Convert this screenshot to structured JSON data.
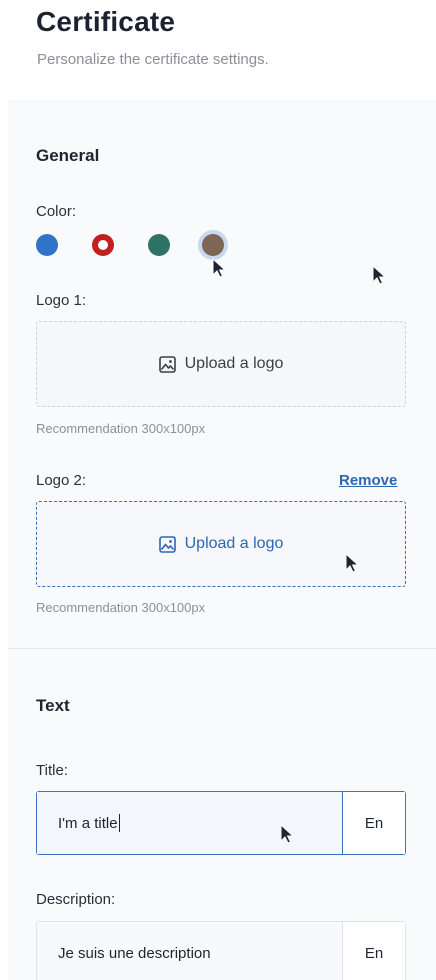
{
  "header": {
    "title": "Certificate",
    "subtitle": "Personalize the certificate settings."
  },
  "general": {
    "title": "General",
    "color_label": "Color:",
    "colors": [
      {
        "name": "blue",
        "hex": "#2f74c9",
        "selected": false
      },
      {
        "name": "red",
        "hex": "#c2201f",
        "selected": false
      },
      {
        "name": "teal",
        "hex": "#2e7466",
        "selected": false
      },
      {
        "name": "brown",
        "hex": "#7d6654",
        "selected": true
      }
    ],
    "logo1": {
      "label": "Logo 1:",
      "upload_label": "Upload a logo",
      "icon": "image-icon",
      "hint": "Recommendation 300x100px"
    },
    "logo2": {
      "label": "Logo 2:",
      "remove_label": "Remove",
      "upload_label": "Upload a logo",
      "icon": "image-icon",
      "hint": "Recommendation 300x100px"
    }
  },
  "text_section": {
    "title": "Text",
    "title_field": {
      "label": "Title:",
      "value": "I'm a title",
      "language": "En"
    },
    "description_field": {
      "label": "Description:",
      "value": "Je suis une description",
      "language": "En"
    }
  },
  "colors": {
    "accent": "#2c66b7",
    "selection_ring": "#c9d8ee"
  }
}
